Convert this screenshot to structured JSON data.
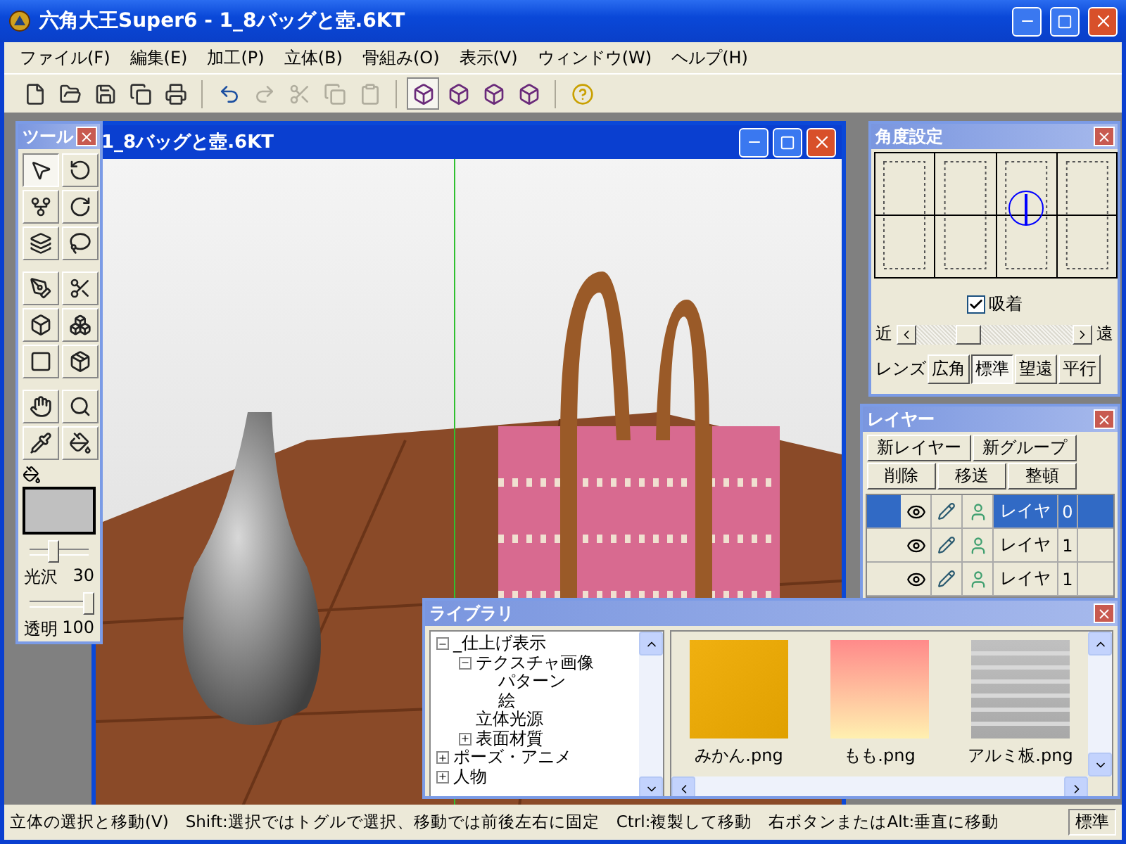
{
  "window": {
    "title": "六角大王Super6 - 1_8バッグと壺.6KT"
  },
  "menu": [
    "ファイル(F)",
    "編集(E)",
    "加工(P)",
    "立体(B)",
    "骨組み(O)",
    "表示(V)",
    "ウィンドウ(W)",
    "ヘルプ(H)"
  ],
  "toolbar": {
    "buttons": [
      {
        "disabled": false
      },
      {
        "disabled": false
      },
      {
        "disabled": false
      },
      {
        "disabled": false
      },
      {
        "disabled": false
      },
      {
        "disabled": false
      },
      {
        "disabled": true
      },
      {
        "disabled": true
      },
      {
        "disabled": true
      },
      {
        "disabled": true
      }
    ],
    "views": [
      {
        "selected": true
      },
      {
        "selected": false
      },
      {
        "selected": false
      },
      {
        "selected": false
      }
    ]
  },
  "document": {
    "title": "1_8バッグと壺.6KT"
  },
  "tools": {
    "title": "ツール",
    "buttons": [
      {
        "selected": true
      },
      {
        "selected": false
      },
      {
        "selected": false
      },
      {
        "selected": false
      },
      {
        "selected": false
      },
      {
        "selected": false
      },
      {
        "selected": false
      },
      {
        "selected": false
      },
      {
        "selected": false
      },
      {
        "selected": false
      },
      {
        "selected": false
      },
      {
        "selected": false
      },
      {
        "selected": false
      },
      {
        "selected": false
      },
      {
        "selected": false
      },
      {
        "selected": false
      }
    ],
    "gloss": {
      "label": "光沢",
      "value": "30",
      "level": 0.4
    },
    "transparency": {
      "label": "透明",
      "value": "100",
      "level": 1
    }
  },
  "angle": {
    "title": "角度設定",
    "snap": {
      "label": "吸着",
      "checked": true
    },
    "near": "近",
    "far": "遠",
    "distance": {
      "level": 0.3
    },
    "lens_label": "レンズ",
    "lens": [
      {
        "label": "広角",
        "selected": false
      },
      {
        "label": "標準",
        "selected": true
      },
      {
        "label": "望遠",
        "selected": false
      },
      {
        "label": "平行",
        "selected": false
      }
    ]
  },
  "layers": {
    "title": "レイヤー",
    "buttons": [
      "新レイヤー",
      "新グループ",
      "削除",
      "移送",
      "整頓"
    ],
    "rows": [
      {
        "name": "レイヤ",
        "number": "0",
        "selected": true
      },
      {
        "name": "レイヤ",
        "number": "1",
        "selected": false
      },
      {
        "name": "レイヤ",
        "number": "1",
        "selected": false
      }
    ]
  },
  "library": {
    "title": "ライブラリ",
    "tree": [
      {
        "label": "_仕上げ表示",
        "expanded": true,
        "children": [
          {
            "label": "テクスチャ画像",
            "expanded": true,
            "children": [
              {
                "label": "パターン"
              },
              {
                "label": "絵"
              }
            ]
          },
          {
            "label": "立体光源"
          },
          {
            "label": "表面材質",
            "expanded": false
          }
        ]
      },
      {
        "label": "ポーズ・アニメ",
        "expanded": false
      },
      {
        "label": "人物",
        "expanded": false
      }
    ],
    "items": [
      {
        "name": "みかん.png"
      },
      {
        "name": "もも.png"
      },
      {
        "name": "アルミ板.png"
      }
    ]
  },
  "status": {
    "text": "立体の選択と移動(V)",
    "hints": [
      "Shift:選択ではトグルで選択、移動では前後左右に固定",
      "Ctrl:複製して移動",
      "右ボタンまたはAlt:垂直に移動"
    ],
    "mode": "標準"
  }
}
